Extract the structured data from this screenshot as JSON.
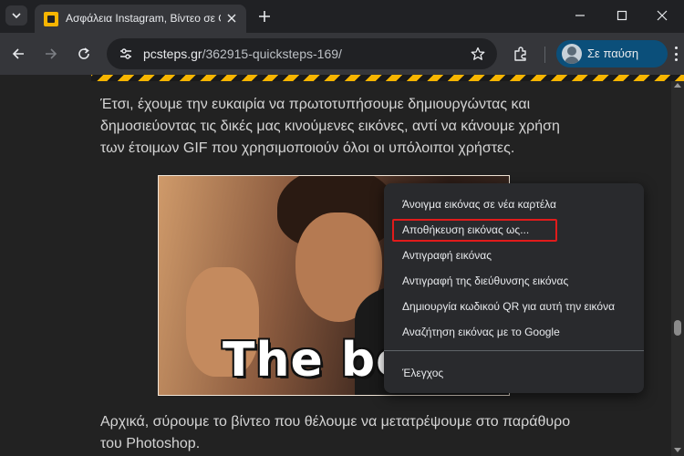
{
  "browser": {
    "tab": {
      "title": "Ασφάλεια Instagram, Βίντεο σε GIF"
    },
    "address_bar": {
      "host": "pcsteps.gr",
      "path": "/362915-quicksteps-169/"
    },
    "profile": {
      "label": "Σε παύση"
    }
  },
  "article": {
    "paragraph_1": "Έτσι, έχουμε την ευκαιρία να πρωτοτυπήσουμε δημιουργώντας και δημοσιεύοντας τις δικές μας κινούμενες εικόνες, αντί να κάνουμε χρήση των έτοιμων GIF που χρησιμοποιούν όλοι οι υπόλοιποι χρήστες.",
    "image_caption": "The be",
    "paragraph_2": "Αρχικά, σύρουμε το βίντεο που θέλουμε να μετατρέψουμε στο παράθυρο του Photoshop."
  },
  "context_menu": {
    "items": [
      "Άνοιγμα εικόνας σε νέα καρτέλα",
      "Αποθήκευση εικόνας ως...",
      "Αντιγραφή εικόνας",
      "Αντιγραφή της διεύθυνσης εικόνας",
      "Δημιουργία κωδικού QR για αυτή την εικόνα",
      "Αναζήτηση εικόνας με το Google",
      "Έλεγχος"
    ],
    "highlighted_index": 1
  },
  "colors": {
    "highlight": "#e11b1b",
    "accent_stripe": "#f7b500",
    "profile_button": "#0b4f7a"
  },
  "icons": {
    "tab_search": "chevron-down-icon",
    "tab_close": "close-icon",
    "new_tab": "plus-icon",
    "back": "arrow-left-icon",
    "forward": "arrow-right-icon",
    "reload": "reload-icon",
    "site_info": "tune-icon",
    "bookmark": "star-icon",
    "extensions": "puzzle-icon",
    "menu": "kebab-menu-icon"
  }
}
